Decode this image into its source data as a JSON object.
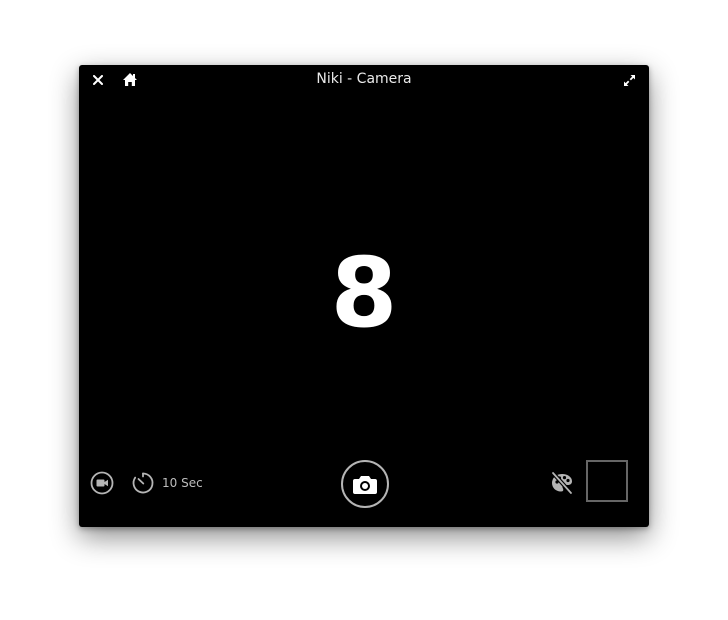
{
  "window": {
    "title": "Niki - Camera"
  },
  "titlebar": {
    "close_icon": "close-icon",
    "home_icon": "home-icon",
    "maximize_icon": "maximize-icon"
  },
  "viewfinder": {
    "countdown": "8"
  },
  "controls": {
    "video_icon": "video-camera-icon",
    "timer_icon": "timer-icon",
    "timer_label": "10 Sec",
    "shutter_icon": "camera-icon",
    "effects_icon": "palette-disabled-icon",
    "thumbnail": "last-photo-thumbnail"
  },
  "colors": {
    "window_bg": "#000000",
    "text": "#eaeaea",
    "icon": "#b5b5b5",
    "thumbnail_border": "#666666"
  }
}
